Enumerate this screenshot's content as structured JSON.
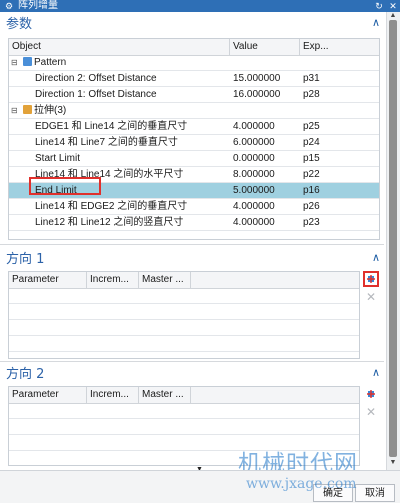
{
  "window": {
    "title": "阵列增量"
  },
  "params_section": {
    "header": "参数",
    "columns": [
      "Object",
      "Value",
      "Exp..."
    ],
    "rows": [
      {
        "indent": 0,
        "expander": "minus",
        "icon": "pattern-icon",
        "object": "Pattern",
        "value": "",
        "exp": ""
      },
      {
        "indent": 2,
        "object": "Direction 2: Offset Distance",
        "value": "15.000000",
        "exp": "p31"
      },
      {
        "indent": 2,
        "object": "Direction 1: Offset Distance",
        "value": "16.000000",
        "exp": "p28"
      },
      {
        "indent": 0,
        "expander": "minus",
        "icon": "extrude-icon",
        "object": "拉伸(3)",
        "value": "",
        "exp": ""
      },
      {
        "indent": 2,
        "object": "EDGE1 和 Line14 之间的垂直尺寸",
        "value": "4.000000",
        "exp": "p25"
      },
      {
        "indent": 2,
        "object": "Line14 和 Line7 之间的垂直尺寸",
        "value": "6.000000",
        "exp": "p24"
      },
      {
        "indent": 2,
        "object": "Start Limit",
        "value": "0.000000",
        "exp": "p15"
      },
      {
        "indent": 2,
        "object": "Line14 和 Line14 之间的水平尺寸",
        "value": "8.000000",
        "exp": "p22"
      },
      {
        "indent": 2,
        "object": "End Limit",
        "value": "5.000000",
        "exp": "p16",
        "selected": true
      },
      {
        "indent": 2,
        "object": "Line14 和 EDGE2 之间的垂直尺寸",
        "value": "4.000000",
        "exp": "p26"
      },
      {
        "indent": 2,
        "object": "Line12 和 Line12 之间的竖直尺寸",
        "value": "4.000000",
        "exp": "p23"
      }
    ]
  },
  "direction1_section": {
    "header": "方向 1",
    "columns": [
      "Parameter",
      "Increm...",
      "Master ..."
    ]
  },
  "direction2_section": {
    "header": "方向 2",
    "columns": [
      "Parameter",
      "Increm...",
      "Master ..."
    ]
  },
  "buttons": {
    "ok": "确定",
    "cancel": "取消"
  },
  "watermark": {
    "line1": "机械时代网",
    "line2": "www.jxage.com"
  },
  "colors": {
    "accent": "#2c62a8",
    "titlebar": "#2e6fb6",
    "selection": "#9fd0e0",
    "highlight": "#e0302c"
  }
}
